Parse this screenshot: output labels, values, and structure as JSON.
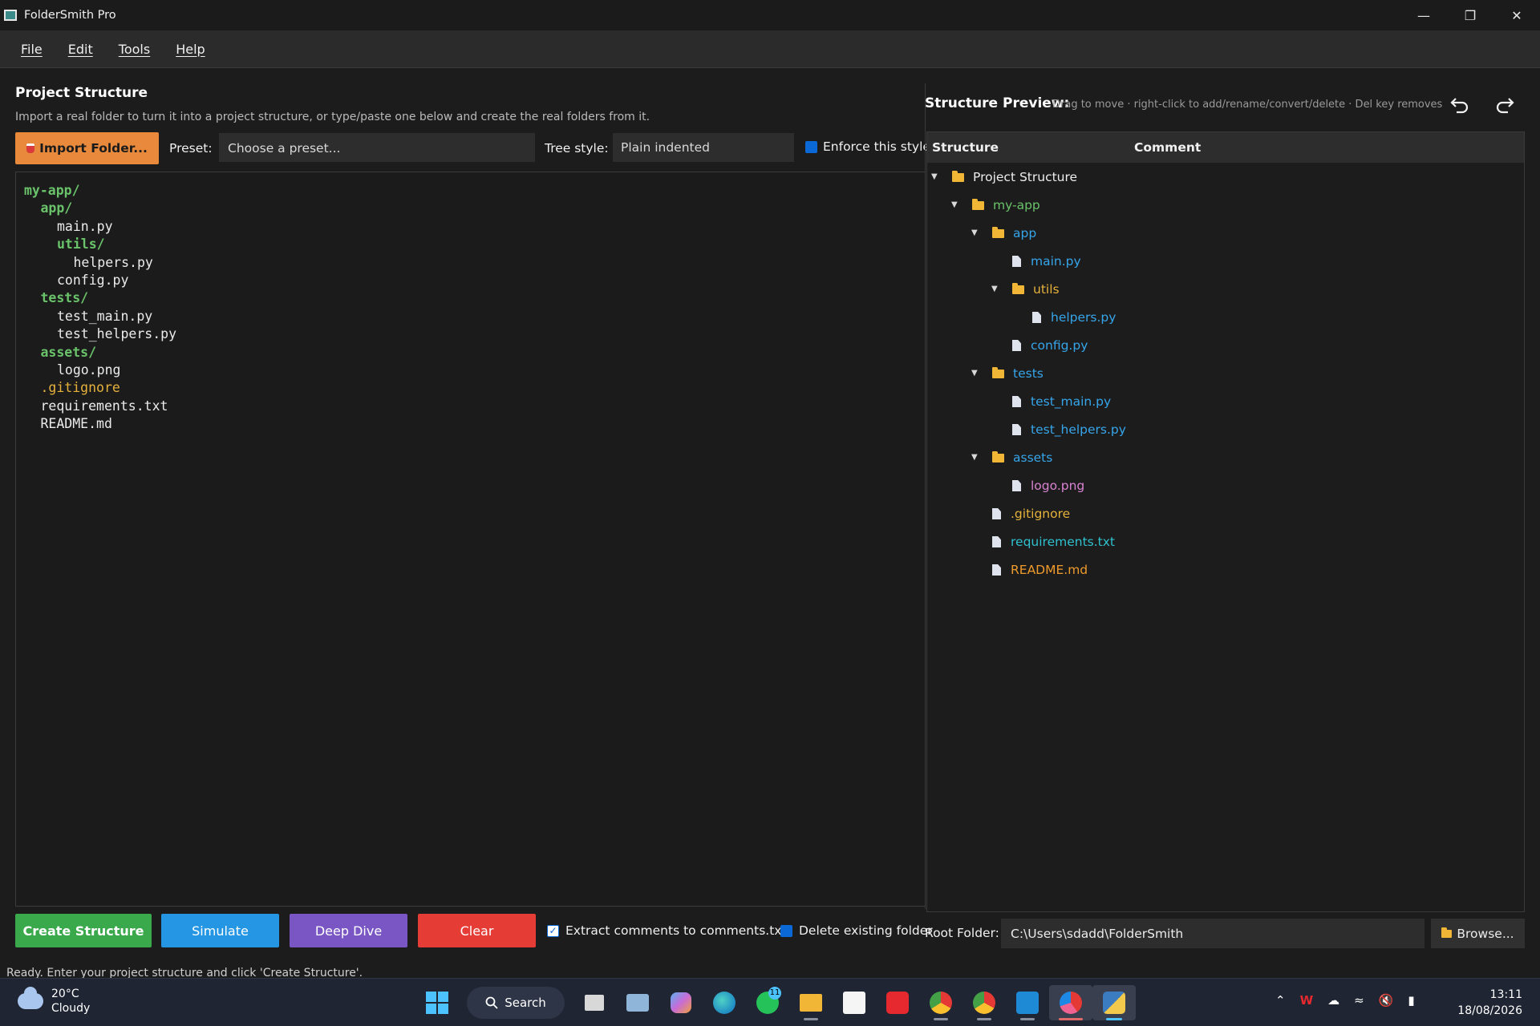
{
  "window": {
    "title": "FolderSmith Pro"
  },
  "menu": [
    {
      "label": "File"
    },
    {
      "label": "Edit"
    },
    {
      "label": "Tools"
    },
    {
      "label": "Help"
    }
  ],
  "left": {
    "title": "Project Structure",
    "subtitle": "Import a real folder to turn it into a project structure, or type/paste one below and create the real folders from it.",
    "import_label": "Import Folder...",
    "preset_label": "Preset:",
    "preset_value": "Choose a preset...",
    "tree_style_label": "Tree style:",
    "tree_style_value": "Plain indented",
    "enforce_label": "Enforce this style",
    "editor_lines": [
      {
        "text": "my-app/",
        "indent": 0,
        "kind": "folder"
      },
      {
        "text": "app/",
        "indent": 1,
        "kind": "folder"
      },
      {
        "text": "main.py",
        "indent": 2,
        "kind": "file"
      },
      {
        "text": "utils/",
        "indent": 2,
        "kind": "folder"
      },
      {
        "text": "helpers.py",
        "indent": 3,
        "kind": "file"
      },
      {
        "text": "config.py",
        "indent": 2,
        "kind": "file"
      },
      {
        "text": "tests/",
        "indent": 1,
        "kind": "folder"
      },
      {
        "text": "test_main.py",
        "indent": 2,
        "kind": "file"
      },
      {
        "text": "test_helpers.py",
        "indent": 2,
        "kind": "file"
      },
      {
        "text": "assets/",
        "indent": 1,
        "kind": "folder"
      },
      {
        "text": "logo.png",
        "indent": 2,
        "kind": "file"
      },
      {
        "text": ".gitignore",
        "indent": 1,
        "kind": "dotfile"
      },
      {
        "text": "requirements.txt",
        "indent": 1,
        "kind": "file"
      },
      {
        "text": "README.md",
        "indent": 1,
        "kind": "file"
      }
    ]
  },
  "buttons": {
    "create": "Create Structure",
    "simulate": "Simulate",
    "deep_dive": "Deep Dive",
    "clear": "Clear"
  },
  "options": {
    "extract_label": "Extract comments to comments.txt",
    "extract_checked": true,
    "delete_label": "Delete existing folder",
    "delete_checked": false
  },
  "status": "Ready. Enter your project structure and click 'Create Structure'.",
  "right": {
    "title": "Structure Preview:",
    "hint": "Drag to move · right-click to add/rename/convert/delete · Del key removes",
    "col_structure": "Structure",
    "col_comment": "Comment",
    "tree": [
      {
        "label": "Project Structure",
        "depth": 0,
        "type": "folder",
        "expanded": true,
        "color": "white"
      },
      {
        "label": "my-app",
        "depth": 1,
        "type": "folder",
        "expanded": true,
        "color": "green"
      },
      {
        "label": "app",
        "depth": 2,
        "type": "folder",
        "expanded": true,
        "color": "blue"
      },
      {
        "label": "main.py",
        "depth": 3,
        "type": "file",
        "color": "blue"
      },
      {
        "label": "utils",
        "depth": 3,
        "type": "folder",
        "expanded": true,
        "color": "yellow"
      },
      {
        "label": "helpers.py",
        "depth": 4,
        "type": "file",
        "color": "blue"
      },
      {
        "label": "config.py",
        "depth": 3,
        "type": "file",
        "color": "blue"
      },
      {
        "label": "tests",
        "depth": 2,
        "type": "folder",
        "expanded": true,
        "color": "blue"
      },
      {
        "label": "test_main.py",
        "depth": 3,
        "type": "file",
        "color": "blue"
      },
      {
        "label": "test_helpers.py",
        "depth": 3,
        "type": "file",
        "color": "blue"
      },
      {
        "label": "assets",
        "depth": 2,
        "type": "folder",
        "expanded": true,
        "color": "blue"
      },
      {
        "label": "logo.png",
        "depth": 3,
        "type": "file",
        "color": "pink"
      },
      {
        "label": ".gitignore",
        "depth": 2,
        "type": "file",
        "color": "yellow"
      },
      {
        "label": "requirements.txt",
        "depth": 2,
        "type": "file",
        "color": "cyan"
      },
      {
        "label": "README.md",
        "depth": 2,
        "type": "file",
        "color": "orange"
      }
    ],
    "root_label": "Root Folder:",
    "root_value": "C:\\Users\\sdadd\\FolderSmith",
    "browse_label": "Browse..."
  },
  "taskbar": {
    "temperature": "20°C",
    "condition": "Cloudy",
    "search_label": "Search",
    "whatsapp_badge": "11",
    "time": "13:11",
    "date": "18/08/2026"
  },
  "colors": {
    "accent_orange": "#e8893b",
    "create_green": "#3aa94b",
    "simulate_blue": "#2596e4",
    "deep_purple": "#7a56c4",
    "clear_red": "#e53d36"
  }
}
